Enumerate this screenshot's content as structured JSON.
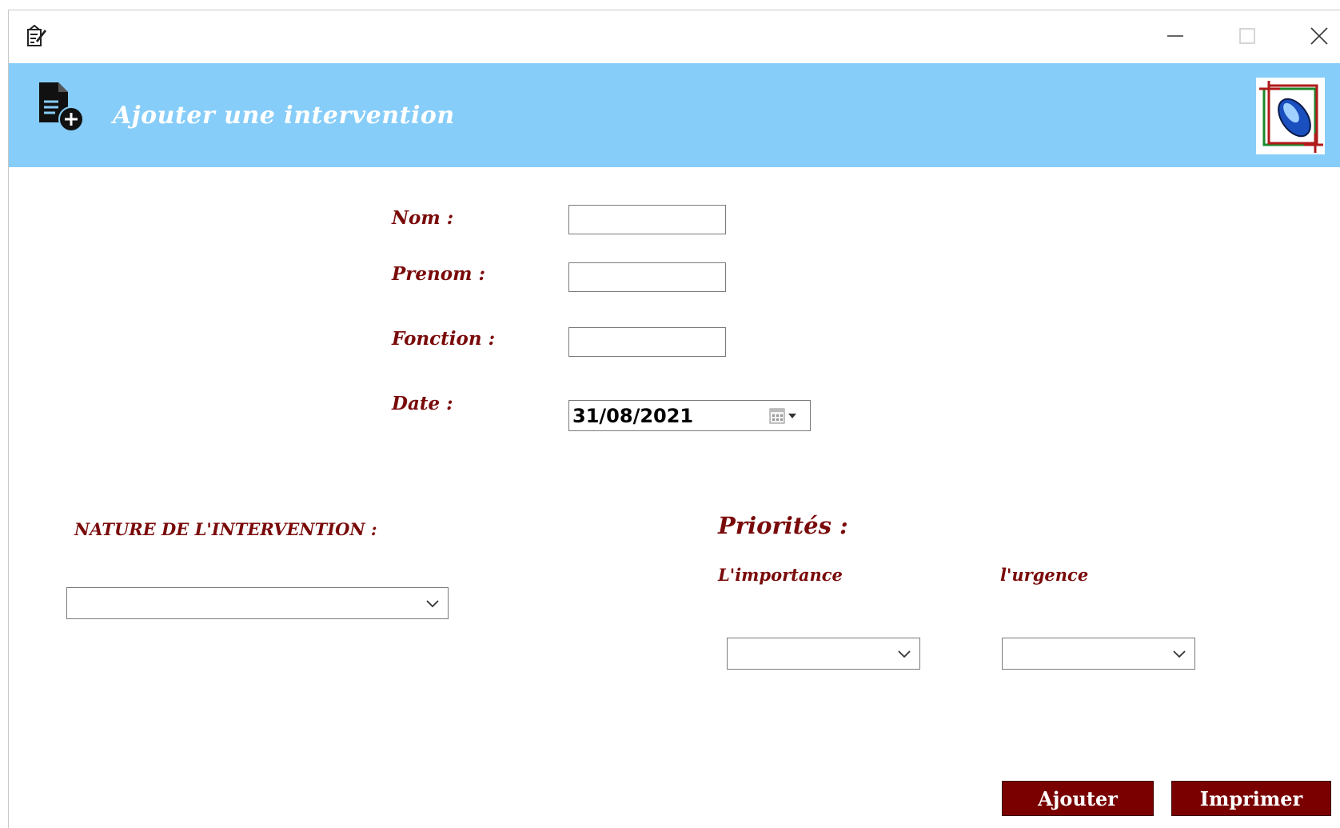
{
  "window": {
    "controls": [
      "minimize-icon",
      "maximize-icon",
      "close-icon"
    ]
  },
  "header": {
    "title": "Ajouter une intervention",
    "background": "#87cdf9"
  },
  "form": {
    "nom_label": "Nom :",
    "prenom_label": "Prenom :",
    "fonction_label": "Fonction :",
    "date_label": "Date :",
    "nom_value": "",
    "prenom_value": "",
    "fonction_value": "",
    "date_value": "31/08/2021"
  },
  "nature": {
    "label": "NATURE DE L'INTERVENTION :",
    "selected": ""
  },
  "priorites": {
    "title": "Priorités :",
    "importance_label": "L'importance",
    "urgence_label": "l'urgence",
    "importance_selected": "",
    "urgence_selected": ""
  },
  "buttons": {
    "ajouter": "Ajouter",
    "imprimer": "Imprimer"
  },
  "colors": {
    "label": "#7a0a0a",
    "button": "#7a0000"
  }
}
